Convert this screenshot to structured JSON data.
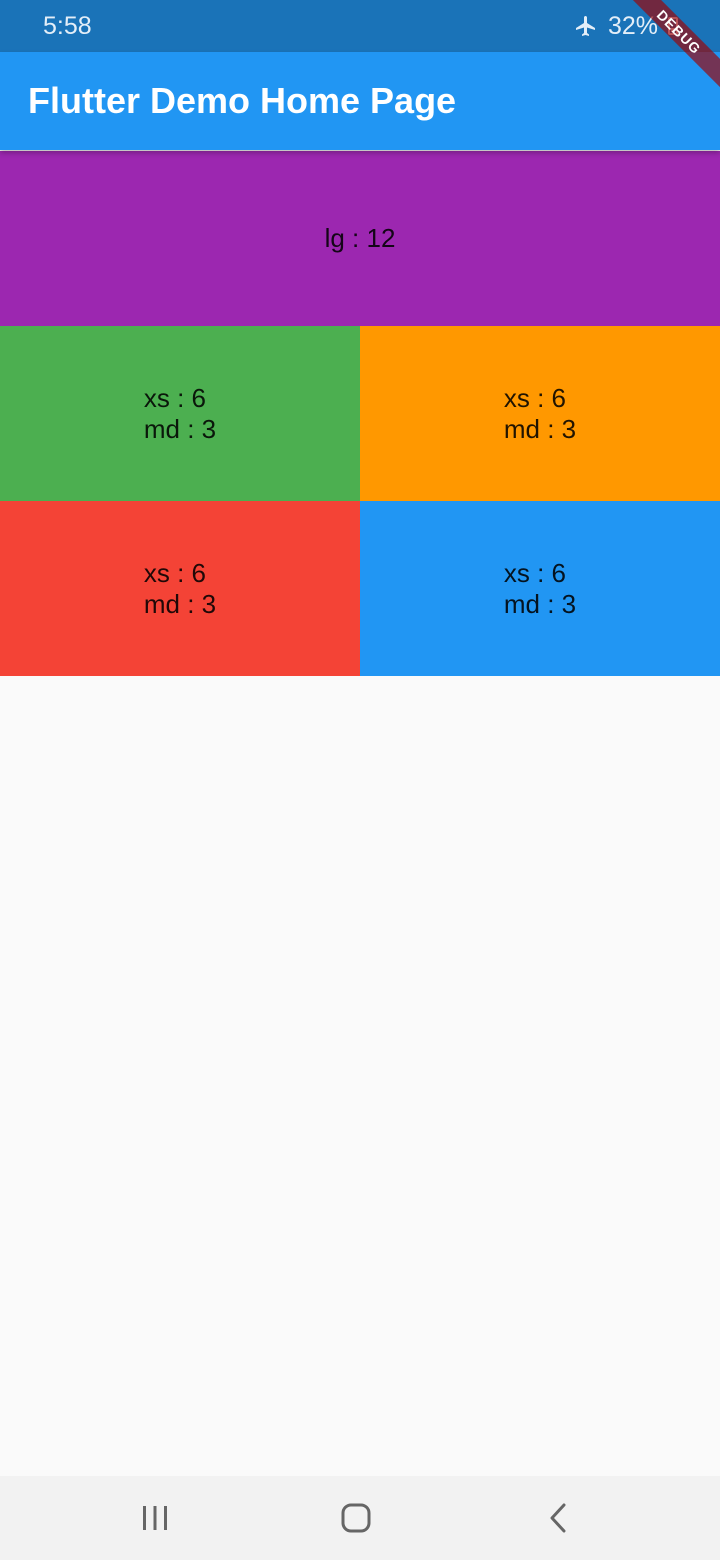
{
  "status_bar": {
    "time": "5:58",
    "battery_percent": "32%",
    "icons": [
      "airplane-icon",
      "battery-icon"
    ]
  },
  "app_bar": {
    "title": "Flutter Demo Home Page",
    "color": "#2196f3"
  },
  "debug_banner": "DEBUG",
  "grid": {
    "rows": [
      [
        {
          "text": "lg : 12",
          "color": "#9c27b0"
        }
      ],
      [
        {
          "text": "xs : 6\nmd : 3",
          "color": "#4caf50"
        },
        {
          "text": "xs : 6\nmd : 3",
          "color": "#ff9800"
        }
      ],
      [
        {
          "text": "xs : 6\nmd : 3",
          "color": "#f44336"
        },
        {
          "text": "xs : 6\nmd : 3",
          "color": "#2196f3"
        }
      ]
    ]
  },
  "nav_bar": {
    "buttons": [
      "recent-apps-icon",
      "home-icon",
      "back-icon"
    ]
  }
}
